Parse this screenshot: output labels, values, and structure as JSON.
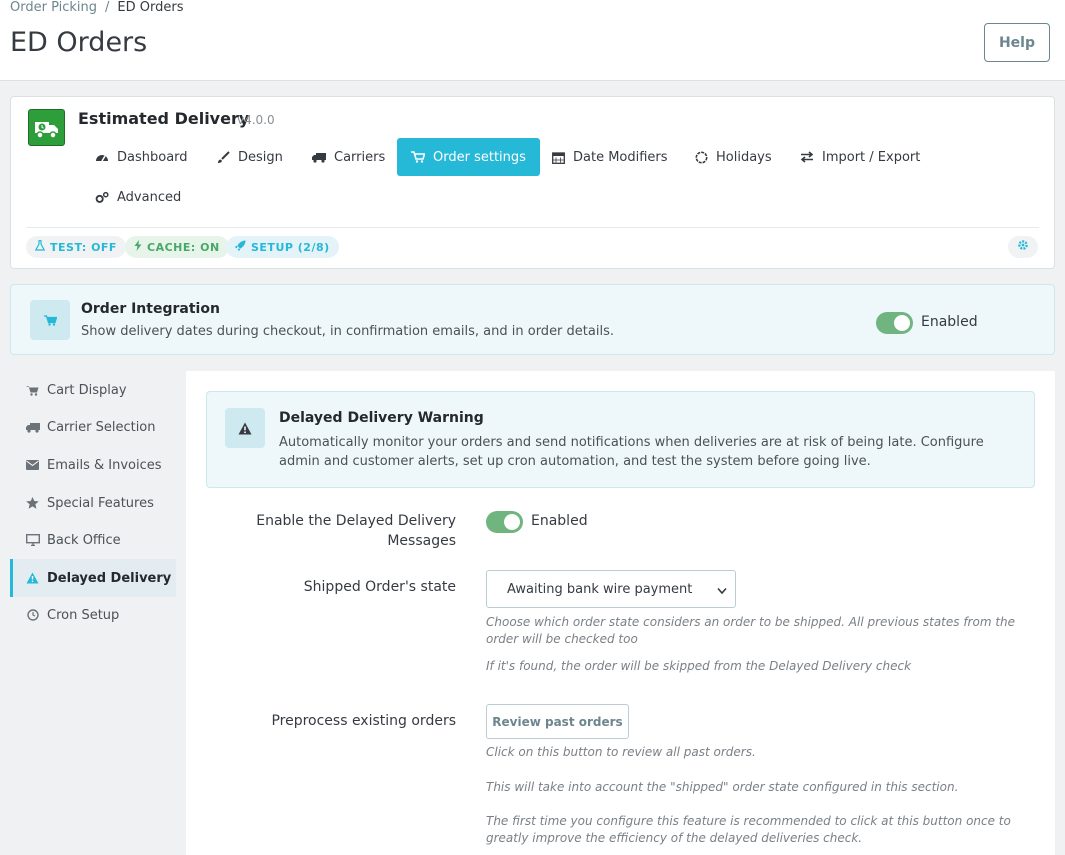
{
  "header": {
    "breadcrumb": [
      "Order Picking",
      "ED Orders"
    ],
    "breadcrumb_sep": "/",
    "title": "ED Orders",
    "help_label": "Help"
  },
  "module": {
    "name": "Estimated Delivery",
    "version": "v4.0.0",
    "tabs": [
      {
        "label": "Dashboard",
        "icon": "dashboard-icon"
      },
      {
        "label": "Design",
        "icon": "brush-icon"
      },
      {
        "label": "Carriers",
        "icon": "truck-icon"
      },
      {
        "label": "Order settings",
        "icon": "cart-icon",
        "active": true
      },
      {
        "label": "Date Modifiers",
        "icon": "calendar-icon"
      },
      {
        "label": "Holidays",
        "icon": "circle-icon"
      },
      {
        "label": "Import / Export",
        "icon": "exchange-icon"
      },
      {
        "label": "Advanced",
        "icon": "cogs-icon"
      }
    ],
    "pills": {
      "test": "TEST: OFF",
      "cache": "CACHE: ON",
      "setup": "SETUP (2/8)"
    }
  },
  "integration": {
    "title": "Order Integration",
    "description": "Show delivery dates during checkout, in confirmation emails, and in order details.",
    "toggle_label": "Enabled",
    "enabled": true
  },
  "sidenav": {
    "items": [
      {
        "label": "Cart Display",
        "icon": "cart-icon"
      },
      {
        "label": "Carrier Selection",
        "icon": "truck-icon"
      },
      {
        "label": "Emails & Invoices",
        "icon": "envelope-icon"
      },
      {
        "label": "Special Features",
        "icon": "star-icon"
      },
      {
        "label": "Back Office",
        "icon": "desktop-icon"
      },
      {
        "label": "Delayed Delivery",
        "icon": "warning-icon",
        "active": true
      },
      {
        "label": "Cron Setup",
        "icon": "clock-icon"
      }
    ]
  },
  "panel": {
    "warning": {
      "title": "Delayed Delivery Warning",
      "description": "Automatically monitor your orders and send notifications when deliveries are at risk of being late. Configure admin and customer alerts, set up cron automation, and test the system before going live."
    },
    "enable": {
      "label": "Enable the Delayed Delivery Messages",
      "toggle_label": "Enabled",
      "enabled": true
    },
    "shipped_state": {
      "label": "Shipped Order's state",
      "selected": "Awaiting bank wire payment",
      "help1": "Choose which order state considers an order to be shipped. All previous states from the order will be checked too",
      "help2": "If it's found, the order will be skipped from the Delayed Delivery check"
    },
    "preprocess": {
      "label": "Preprocess existing orders",
      "button_label": "Review past orders",
      "help1": "Click on this button to review all past orders.",
      "help2": "This will take into account the \"shipped\" order state configured in this section.",
      "help3": "The first time you configure this feature is recommended to click at this button once to greatly improve the efficiency of the delayed deliveries check."
    }
  },
  "colors": {
    "accent": "#25b9d7",
    "toggle_on": "#70b580",
    "background": "#eff1f2"
  }
}
